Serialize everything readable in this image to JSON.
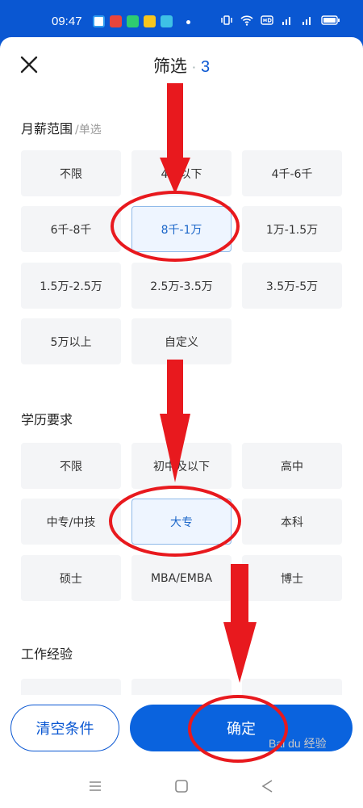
{
  "status_bar": {
    "time": "09:47",
    "app_icon_colors": [
      "#2f9bf0",
      "#e8453c",
      "#2ecc71",
      "#f7c51e",
      "#3ec1e6"
    ]
  },
  "header": {
    "title": "筛选",
    "dot": "·",
    "count": "3",
    "close_icon": "close-icon"
  },
  "salary": {
    "title": "月薪范围",
    "subtitle": "/单选",
    "options": [
      "不限",
      "4千以下",
      "4千-6千",
      "6千-8千",
      "8千-1万",
      "1万-1.5万",
      "1.5万-2.5万",
      "2.5万-3.5万",
      "3.5万-5万",
      "5万以上",
      "自定义"
    ],
    "selected": "8千-1万"
  },
  "education": {
    "title": "学历要求",
    "options": [
      "不限",
      "初中及以下",
      "高中",
      "中专/中技",
      "大专",
      "本科",
      "硕士",
      "MBA/EMBA",
      "博士"
    ],
    "selected": "大专"
  },
  "experience": {
    "title": "工作经验"
  },
  "actions": {
    "clear_label": "清空条件",
    "confirm_label": "确定"
  },
  "watermark": "Bai du 经验",
  "colors": {
    "accent": "#0a57d2",
    "selected_bg": "#eef5ff",
    "annotation_red": "#e8191e"
  }
}
